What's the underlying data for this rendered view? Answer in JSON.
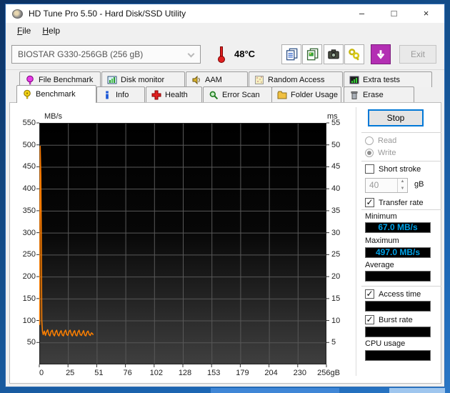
{
  "window": {
    "title": "HD Tune Pro 5.50 - Hard Disk/SSD Utility",
    "controls": {
      "minimize": "–",
      "maximize": "□",
      "close": "×"
    }
  },
  "menu": {
    "items": [
      {
        "label": "File"
      },
      {
        "label": "Help"
      }
    ]
  },
  "toolbar": {
    "drive_selector_value": "BIOSTAR G330-256GB (256 gB)",
    "temperature": "48°C",
    "buttons": [
      {
        "name": "copy-text"
      },
      {
        "name": "copy-image"
      },
      {
        "name": "screenshot"
      },
      {
        "name": "save"
      },
      {
        "name": "download"
      }
    ],
    "exit_label": "Exit"
  },
  "tabs": {
    "back_row": [
      {
        "label": "File Benchmark",
        "icon": "file-benchmark"
      },
      {
        "label": "Disk monitor",
        "icon": "disk-monitor"
      },
      {
        "label": "AAM",
        "icon": "aam"
      },
      {
        "label": "Random Access",
        "icon": "random-access"
      },
      {
        "label": "Extra tests",
        "icon": "extra-tests"
      }
    ],
    "front_row": [
      {
        "label": "Benchmark",
        "icon": "benchmark",
        "active": true
      },
      {
        "label": "Info",
        "icon": "info"
      },
      {
        "label": "Health",
        "icon": "health"
      },
      {
        "label": "Error Scan",
        "icon": "error-scan"
      },
      {
        "label": "Folder Usage",
        "icon": "folder-usage"
      },
      {
        "label": "Erase",
        "icon": "erase"
      }
    ]
  },
  "chart_data": {
    "type": "line",
    "ylabel_left": "MB/s",
    "ylabel_right": "ms",
    "y_left_ticks": [
      550,
      500,
      450,
      400,
      350,
      300,
      250,
      200,
      150,
      100,
      50
    ],
    "y_right_ticks": [
      55,
      50,
      45,
      40,
      35,
      30,
      25,
      20,
      15,
      10,
      5
    ],
    "x_ticks": [
      "0",
      "25",
      "51",
      "76",
      "102",
      "128",
      "153",
      "179",
      "204",
      "230",
      "256gB"
    ],
    "x_max": 256,
    "ylim_left": [
      0,
      550
    ],
    "ylim_right": [
      0,
      55
    ],
    "grid": true,
    "background": "#000000",
    "series": [
      {
        "name": "Write transfer rate",
        "color": "#ff8000",
        "points": [
          [
            0.3,
            90
          ],
          [
            0.8,
            497
          ],
          [
            1.4,
            430
          ],
          [
            1.8,
            300
          ],
          [
            2.2,
            100
          ],
          [
            2.8,
            76
          ],
          [
            3.5,
            68
          ],
          [
            4.5,
            76
          ],
          [
            5.5,
            66
          ],
          [
            6.5,
            74
          ],
          [
            7.5,
            79
          ],
          [
            8.5,
            68
          ],
          [
            9.5,
            65
          ],
          [
            10.5,
            75
          ],
          [
            11.5,
            78
          ],
          [
            12.5,
            69
          ],
          [
            13.5,
            65
          ],
          [
            14.5,
            74
          ],
          [
            15.5,
            78
          ],
          [
            16.5,
            68
          ],
          [
            17.5,
            65
          ],
          [
            18.5,
            73
          ],
          [
            19.5,
            77
          ],
          [
            20.5,
            67
          ],
          [
            21.5,
            65
          ],
          [
            22.5,
            74
          ],
          [
            23.5,
            78
          ],
          [
            24.5,
            68
          ],
          [
            25.5,
            66
          ],
          [
            26.5,
            75
          ],
          [
            27.5,
            78
          ],
          [
            28.5,
            69
          ],
          [
            29.5,
            65
          ],
          [
            30.5,
            73
          ],
          [
            31.5,
            77
          ],
          [
            32.5,
            67
          ],
          [
            33.5,
            65
          ],
          [
            34.5,
            74
          ],
          [
            35.5,
            78
          ],
          [
            36.5,
            68
          ],
          [
            37.5,
            66
          ],
          [
            38.5,
            72
          ],
          [
            39.5,
            77
          ],
          [
            40.5,
            67
          ],
          [
            41.5,
            65
          ],
          [
            42.5,
            73
          ],
          [
            43.5,
            76
          ],
          [
            44.5,
            68
          ],
          [
            45.5,
            66
          ],
          [
            46.5,
            72
          ],
          [
            47.5,
            70
          ],
          [
            48,
            67
          ]
        ]
      }
    ]
  },
  "panel": {
    "stop_label": "Stop",
    "radios": [
      {
        "label": "Read",
        "checked": false,
        "disabled": true
      },
      {
        "label": "Write",
        "checked": true,
        "disabled": true
      }
    ],
    "short_stroke": {
      "label": "Short stroke",
      "checked": false
    },
    "short_stroke_value": "40",
    "short_stroke_unit": "gB",
    "transfer_rate": {
      "label": "Transfer rate",
      "checked": true
    },
    "minimum": {
      "label": "Minimum",
      "value": "67.0 MB/s"
    },
    "maximum": {
      "label": "Maximum",
      "value": "497.0 MB/s"
    },
    "average": {
      "label": "Average",
      "value": ""
    },
    "access_time": {
      "label": "Access time",
      "checked": true,
      "value": ""
    },
    "burst_rate": {
      "label": "Burst rate",
      "checked": true,
      "value": ""
    },
    "cpu_usage": {
      "label": "CPU usage",
      "value": ""
    }
  },
  "colors": {
    "accent": "#0078d7",
    "value_text": "#00a2e8",
    "line": "#ff8000",
    "chart_bg": "#000000"
  }
}
